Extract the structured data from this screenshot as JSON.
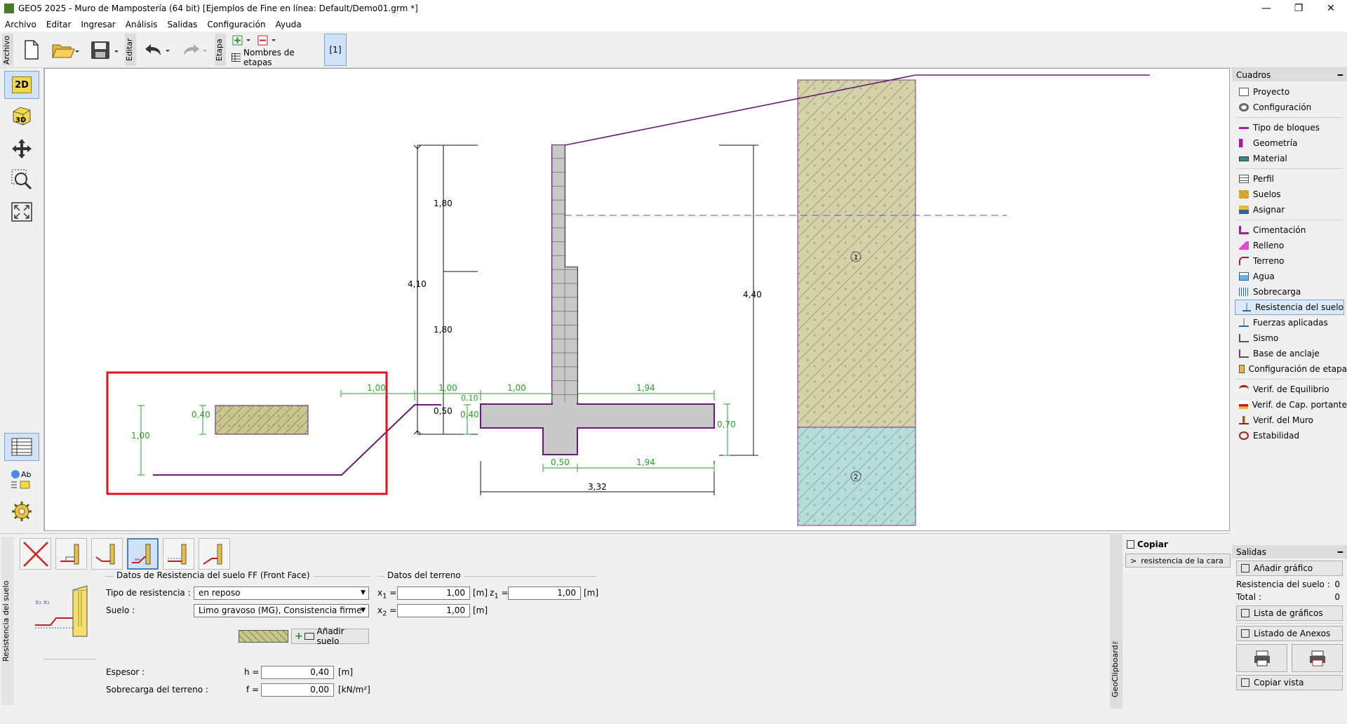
{
  "window": {
    "title": "GEO5 2025 - Muro de Mampostería (64 bit) [Ejemplos de Fine en línea: Default/Demo01.grm *]"
  },
  "menu": [
    "Archivo",
    "Editar",
    "Ingresar",
    "Análisis",
    "Salidas",
    "Configuración",
    "Ayuda"
  ],
  "toolbar": {
    "archivo_label": "Archivo",
    "editar_label": "Editar",
    "etapa_label": "Etapa",
    "stage_names_label": "Nombres de etapas",
    "stage_button": "[1]"
  },
  "left_tools": {
    "view2d": "2D",
    "view3d": "3D"
  },
  "drawing": {
    "dims": [
      "1,80",
      "1,80",
      "4,10",
      "4,40",
      "1,00",
      "1,00",
      "1,00",
      "0,10",
      "0,50",
      "0,40",
      "0,40",
      "1,00",
      "1,94",
      "0,70",
      "0,50",
      "1,94",
      "3,32"
    ],
    "soil_labels": [
      "1",
      "2"
    ]
  },
  "colors": {
    "soil1": "#d4d2a8",
    "soil2": "#b8dcd8",
    "wall": "#c8c8c8",
    "wall_outline": "#6a1a7a",
    "terrain": "#6a1a7a",
    "dim": "#2aa02a",
    "highlight": "#e01020"
  },
  "cuadros": {
    "header": "Cuadros",
    "groups": [
      [
        "Proyecto",
        "Configuración"
      ],
      [
        "Tipo de bloques",
        "Geometría",
        "Material"
      ],
      [
        "Perfil",
        "Suelos",
        "Asignar"
      ],
      [
        "Cimentación",
        "Relleno",
        "Terreno",
        "Agua",
        "Sobrecarga",
        "Resistencia del suelo",
        "Fuerzas aplicadas",
        "Sismo",
        "Base de anclaje",
        "Configuración de etapa"
      ],
      [
        "Verif. de Equilibrio",
        "Verif. de Cap. portante",
        "Verif. del Muro",
        "Estabilidad"
      ]
    ],
    "selected": "Resistencia del suelo"
  },
  "salidas": {
    "header": "Salidas",
    "add_chart": "Añadir gráfico",
    "resist_label": "Resistencia del suelo :",
    "resist_value": "0",
    "total_label": "Total :",
    "total_value": "0",
    "chart_list": "Lista de gráficos",
    "annex_list": "Listado de Anexos",
    "copy_view": "Copiar vista"
  },
  "bottom": {
    "side_label": "Resistencia del suelo",
    "soil_group_title": "Datos de Resistencia del suelo FF (Front Face)",
    "terrain_group_title": "Datos del terreno",
    "resist_type_label": "Tipo de resistencia :",
    "resist_type_value": "en reposo",
    "soil_label": "Suelo :",
    "soil_value": "Limo gravoso (MG), Consistencia firme",
    "add_soil": "Añadir suelo",
    "x1_label": "x",
    "x1_sub": "1",
    "x1_value": "1,00",
    "x1_unit": "[m]",
    "z1_label": "z",
    "z1_sub": "1",
    "z1_value": "1,00",
    "z1_unit": "[m]",
    "x2_label": "x",
    "x2_sub": "2",
    "x2_value": "1,00",
    "x2_unit": "[m]",
    "thickness_label": "Espesor :",
    "h_label": "h =",
    "h_value": "0,40",
    "h_unit": "[m]",
    "surcharge_label": "Sobrecarga del terreno :",
    "f_label": "f =",
    "f_value": "0,00",
    "f_unit": "[kN/m²]"
  },
  "geoclipboard": {
    "label": "GeoClipboard™",
    "copy": "Copiar",
    "item": "resistencia de la cara"
  }
}
